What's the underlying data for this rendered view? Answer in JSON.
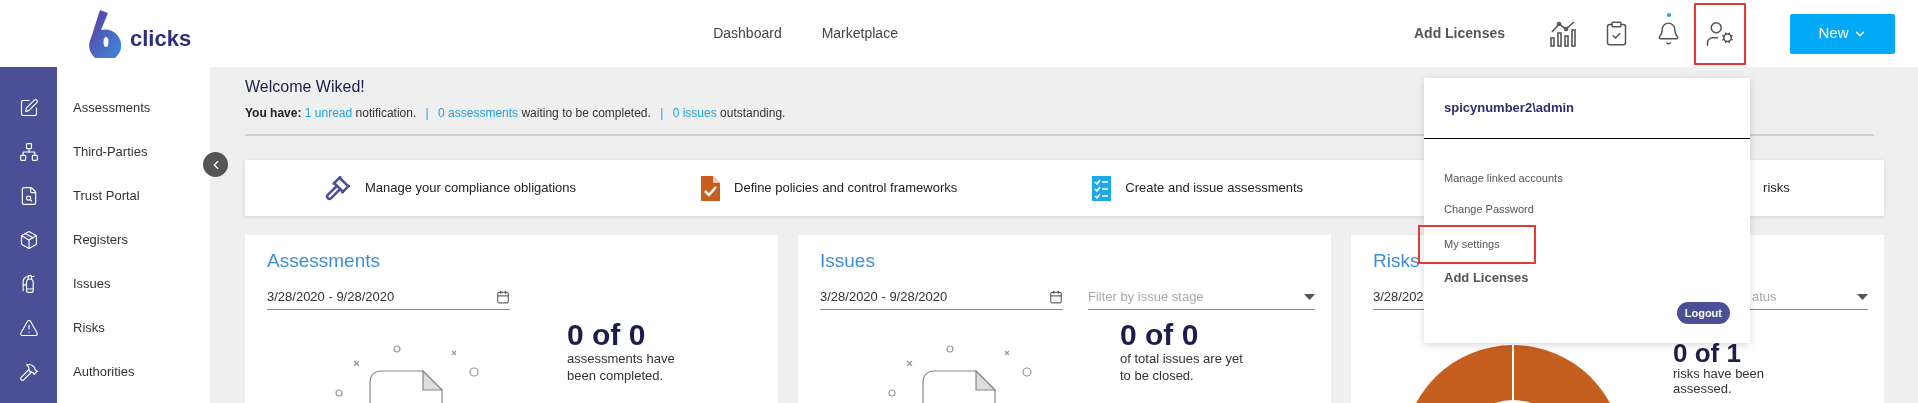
{
  "header": {
    "logo_text": "clicks",
    "nav": [
      {
        "label": "Dashboard"
      },
      {
        "label": "Marketplace"
      }
    ],
    "add_licenses": "Add Licenses",
    "icons": [
      {
        "kind": "chart",
        "highlighted": false
      },
      {
        "kind": "clipboard",
        "highlighted": false
      },
      {
        "kind": "bell",
        "highlighted": false,
        "unread": true
      },
      {
        "kind": "user-settings",
        "highlighted": true
      }
    ],
    "new_button": "New"
  },
  "sidebar": {
    "items": [
      {
        "kind": "edit",
        "label": "Assessments"
      },
      {
        "kind": "network",
        "label": "Third-Parties"
      },
      {
        "kind": "portal",
        "label": "Trust Portal"
      },
      {
        "kind": "box",
        "label": "Registers"
      },
      {
        "kind": "extinguisher",
        "label": "Issues"
      },
      {
        "kind": "warning",
        "label": "Risks"
      },
      {
        "kind": "hammer",
        "label": "Authorities"
      }
    ]
  },
  "welcome": {
    "title": "Welcome Wiked!",
    "summary": [
      {
        "kind": "bold",
        "text": "You have:"
      },
      {
        "kind": "link",
        "text": "1 unread"
      },
      {
        "kind": "text",
        "text": "notification."
      },
      {
        "kind": "separator",
        "text": "|"
      },
      {
        "kind": "link",
        "text": "0 assessments"
      },
      {
        "kind": "text",
        "text": "waiting to be completed."
      },
      {
        "kind": "separator",
        "text": "|"
      },
      {
        "kind": "link",
        "text": "0 issues"
      },
      {
        "kind": "text",
        "text": "outstanding."
      }
    ]
  },
  "banner": [
    {
      "kind": "gavel",
      "text": "Manage your compliance obligations"
    },
    {
      "kind": "policy",
      "text": "Define policies and control frameworks"
    },
    {
      "kind": "checklist",
      "text": "Create and issue assessments"
    },
    {
      "text": "risks"
    }
  ],
  "cards": [
    {
      "kind": "empty",
      "title": "Assessments",
      "date_range": "3/28/2020 - 9/28/2020",
      "count": "0 of 0",
      "caption": "assessments have been completed."
    },
    {
      "kind": "empty",
      "title": "Issues",
      "date_range": "3/28/2020 - 9/28/2020",
      "filter_placeholder": "Filter by issue stage",
      "count": "0 of 0",
      "caption": "of total issues are yet to be closed."
    },
    {
      "kind": "donut",
      "title": "Risks",
      "date_range": "3/28/202",
      "filter_placeholder": "atus",
      "count": "0 of 1",
      "caption": "risks have been assessed."
    }
  ],
  "user_menu": {
    "username": "spicynumber2\\admin",
    "items": [
      {
        "label": "Manage linked accounts",
        "highlighted": false
      },
      {
        "label": "Change Password",
        "highlighted": false
      },
      {
        "label": "My settings",
        "highlighted": true
      }
    ],
    "add_licenses": "Add Licenses",
    "logout": "Logout"
  }
}
